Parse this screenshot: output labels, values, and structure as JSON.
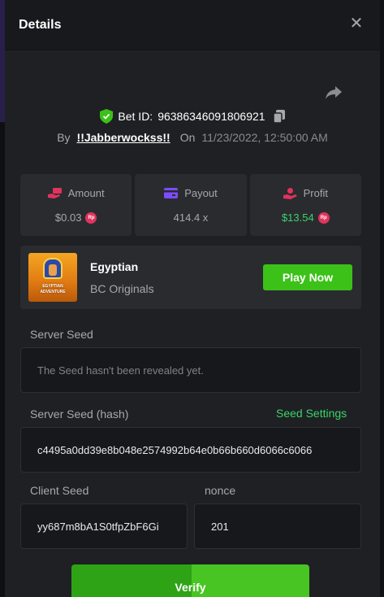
{
  "modal": {
    "title": "Details",
    "close_icon": "close-icon"
  },
  "bet": {
    "id_label": "Bet ID:",
    "id": "96386346091806921",
    "by_label": "By",
    "user": "!!Jabberwockss!!",
    "on_label": "On",
    "datetime": "11/23/2022, 12:50:00 AM"
  },
  "stats": [
    {
      "label": "Amount",
      "value": "$0.03",
      "icon": "money-hand-icon",
      "currency": "Rp"
    },
    {
      "label": "Payout",
      "value": "414.4 x",
      "icon": "card-icon"
    },
    {
      "label": "Profit",
      "value": "$13.54",
      "icon": "profit-hand-icon",
      "currency": "Rp"
    }
  ],
  "game": {
    "thumb_text_line1": "EGYPTIAN",
    "thumb_text_line2": "ADVENTURE",
    "name": "Egyptian",
    "provider": "BC Originals",
    "play_label": "Play Now"
  },
  "server_seed": {
    "label": "Server Seed",
    "placeholder": "The Seed hasn't been revealed yet."
  },
  "server_seed_hash": {
    "label": "Server Seed (hash)",
    "settings_link": "Seed Settings",
    "value": "c4495a0dd39e8b048e2574992b64e0b66b660d6066c6066"
  },
  "client_seed": {
    "label": "Client Seed",
    "value": "yy687m8bA1S0tfpZbF6Gi"
  },
  "nonce": {
    "label": "nonce",
    "value": "201"
  },
  "verify": {
    "label": "Verify"
  },
  "colors": {
    "accent_green": "#3bc117",
    "profit_green": "#39d46a",
    "icon_red": "#e0345c",
    "icon_purple": "#7b4dff",
    "panel": "#2a2b2f",
    "background": "#1f2023"
  }
}
